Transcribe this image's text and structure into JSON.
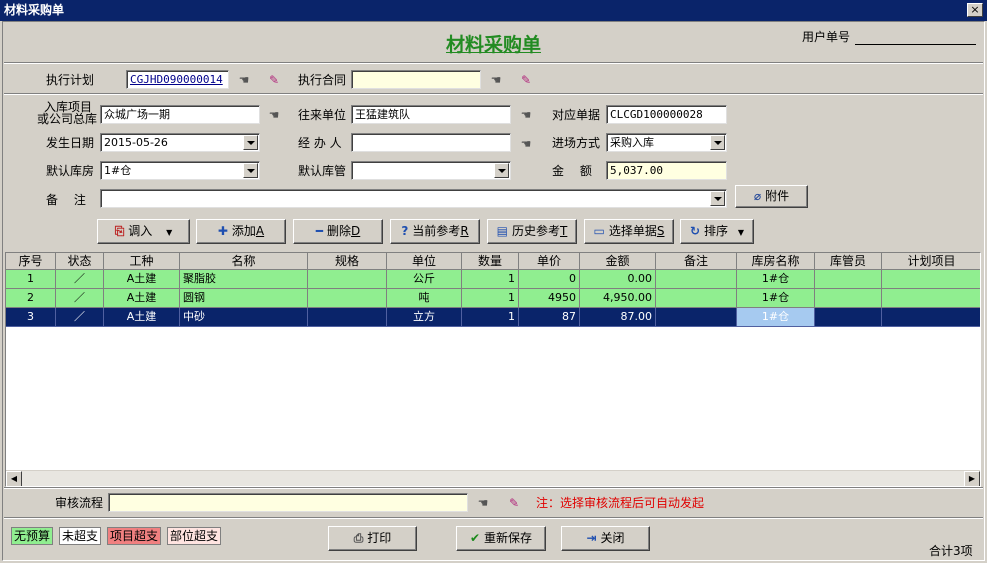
{
  "window": {
    "title": "材料采购单",
    "close_glyph": "×"
  },
  "header": {
    "title": "材料采购单",
    "user_no_label": "用户单号"
  },
  "plan": {
    "exec_plan_label": "执行计划",
    "exec_plan_value": "CGJHD090000014",
    "exec_contract_label": "执行合同",
    "exec_contract_value": ""
  },
  "form": {
    "project_label_1": "入库项目",
    "project_label_2": "或公司总库",
    "project_value": "众城广场一期",
    "partner_label": "往来单位",
    "partner_value": "王猛建筑队",
    "ref_doc_label": "对应单据",
    "ref_doc_value": "CLCGD100000028",
    "date_label": "发生日期",
    "date_value": "2015-05-26",
    "handler_label": "经 办 人",
    "handler_value": "",
    "entry_mode_label": "进场方式",
    "entry_mode_value": "采购入库",
    "default_store_label": "默认库房",
    "default_store_value": "1#仓",
    "default_keeper_label": "默认库管",
    "default_keeper_value": "",
    "amount_label": "金　 额",
    "amount_value": "5,037.00",
    "note_label": "备　 注",
    "note_value": "",
    "attach_label": "附件"
  },
  "toolbar": {
    "import_label": "调入",
    "add_label": "添加",
    "add_key": "A",
    "delete_label": "删除",
    "delete_key": "D",
    "current_ref_label": "当前参考",
    "current_ref_key": "R",
    "history_ref_label": "历史参考",
    "history_ref_key": "T",
    "select_doc_label": "选择单据",
    "select_doc_key": "S",
    "sort_label": "排序"
  },
  "table": {
    "columns": [
      "序号",
      "状态",
      "工种",
      "名称",
      "规格",
      "单位",
      "数量",
      "单价",
      "金额",
      "备注",
      "库房名称",
      "库管员",
      "计划项目"
    ],
    "rows": [
      {
        "no": "1",
        "work": "A土建",
        "name": "聚脂胶",
        "spec": "",
        "unit": "公斤",
        "qty": "1",
        "price": "0",
        "amount": "0.00",
        "note": "",
        "store": "1#仓",
        "keeper": "",
        "plan": ""
      },
      {
        "no": "2",
        "work": "A土建",
        "name": "圆钢",
        "spec": "",
        "unit": "吨",
        "qty": "1",
        "price": "4950",
        "amount": "4,950.00",
        "note": "",
        "store": "1#仓",
        "keeper": "",
        "plan": ""
      },
      {
        "no": "3",
        "work": "A土建",
        "name": "中砂",
        "spec": "",
        "unit": "立方",
        "qty": "1",
        "price": "87",
        "amount": "87.00",
        "note": "",
        "store": "1#仓",
        "keeper": "",
        "plan": ""
      }
    ]
  },
  "audit": {
    "label": "审核流程",
    "value": "",
    "note": "注：选择审核流程后可自动发起"
  },
  "legend": {
    "no_budget": "无预算",
    "not_over": "未超支",
    "project_over": "项目超支",
    "part_over": "部位超支",
    "colors": {
      "no_budget": "#90ee90",
      "not_over": "#ffffff",
      "project_over": "#f08080",
      "part_over": "#ffe4e1"
    }
  },
  "footer": {
    "print_label": "打印",
    "resave_label": "重新保存",
    "close_label": "关闭",
    "total": "合计3项"
  }
}
